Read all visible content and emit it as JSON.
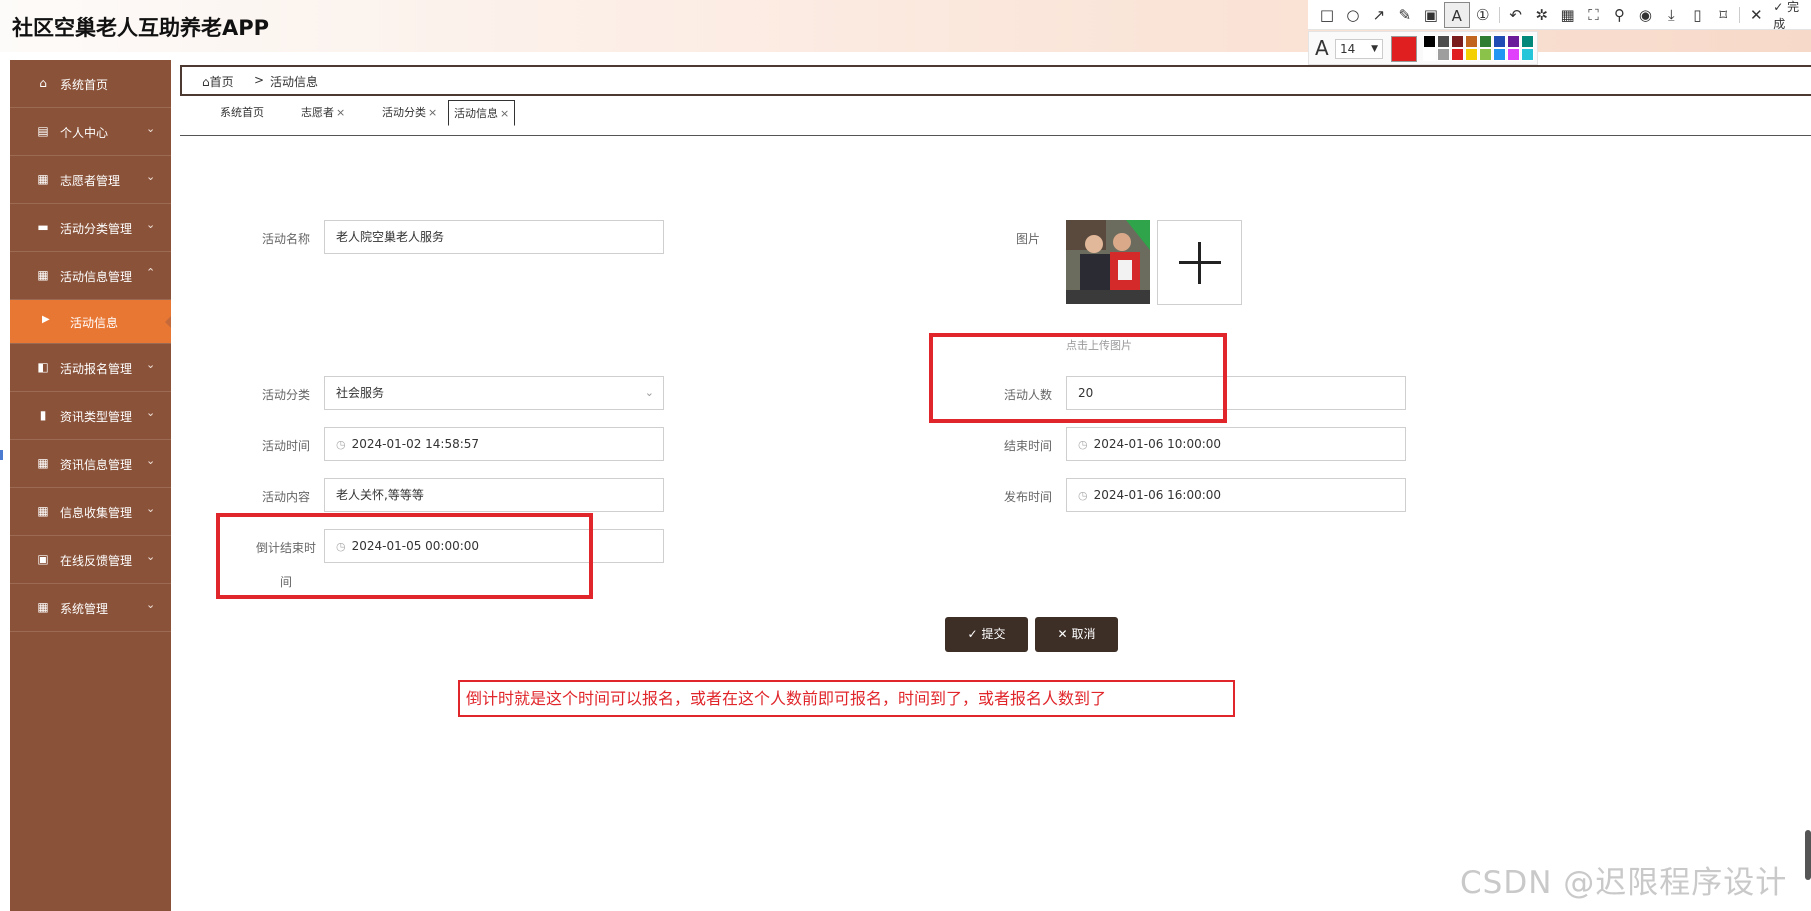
{
  "app": {
    "title": "社区空巢老人互助养老APP"
  },
  "annotation_toolbar": {
    "done_label": "完成",
    "font_size": "14",
    "current_color": "#e02020",
    "palette": [
      "#000000",
      "#4d4d4d",
      "#7a1c1c",
      "#c0641e",
      "#2e7d32",
      "#1e4bb4",
      "#6a1b9a",
      "#00897b",
      "#ffffff",
      "#9e9e9e",
      "#e02020",
      "#f5d000",
      "#8bc34a",
      "#2196f3",
      "#e040fb",
      "#26c6da"
    ]
  },
  "sidebar": {
    "items": [
      {
        "label": "系统首页",
        "icon": "home-icon"
      },
      {
        "label": "个人中心",
        "icon": "calendar-icon"
      },
      {
        "label": "志愿者管理",
        "icon": "grid-icon"
      },
      {
        "label": "活动分类管理",
        "icon": "monitor-icon"
      },
      {
        "label": "活动信息管理",
        "icon": "grid-icon"
      },
      {
        "label": "活动信息",
        "icon": "caret-right-icon"
      },
      {
        "label": "活动报名管理",
        "icon": "thumb-icon"
      },
      {
        "label": "资讯类型管理",
        "icon": "bar-chart-icon"
      },
      {
        "label": "资讯信息管理",
        "icon": "grid-icon"
      },
      {
        "label": "信息收集管理",
        "icon": "grid-icon"
      },
      {
        "label": "在线反馈管理",
        "icon": "clipboard-icon"
      },
      {
        "label": "系统管理",
        "icon": "grid-icon"
      }
    ]
  },
  "breadcrumb": {
    "home": "首页",
    "separator": ">",
    "current": "活动信息"
  },
  "tabs": [
    {
      "label": "系统首页",
      "closable": false
    },
    {
      "label": "志愿者",
      "closable": true
    },
    {
      "label": "活动分类",
      "closable": true
    },
    {
      "label": "活动信息",
      "closable": true,
      "active": true
    }
  ],
  "form": {
    "name_label": "活动名称",
    "name_value": "老人院空巢老人服务",
    "image_label": "图片",
    "upload_hint": "点击上传图片",
    "category_label": "活动分类",
    "category_value": "社会服务",
    "count_label": "活动人数",
    "count_value": "20",
    "start_label": "活动时间",
    "start_value": "2024-01-02 14:58:57",
    "end_label": "结束时间",
    "end_value": "2024-01-06 10:00:00",
    "content_label": "活动内容",
    "content_value": "老人关怀,等等等",
    "publish_label": "发布时间",
    "publish_value": "2024-01-06 16:00:00",
    "countdown_label_1": "倒计结束时",
    "countdown_label_2": "间",
    "countdown_value": "2024-01-05 00:00:00",
    "submit_label": "提交",
    "cancel_label": "取消"
  },
  "annotation_note": "倒计时就是这个时间可以报名，或者在这个人数前即可报名，时间到了，或者报名人数到了",
  "watermark": "CSDN @迟限程序设计"
}
